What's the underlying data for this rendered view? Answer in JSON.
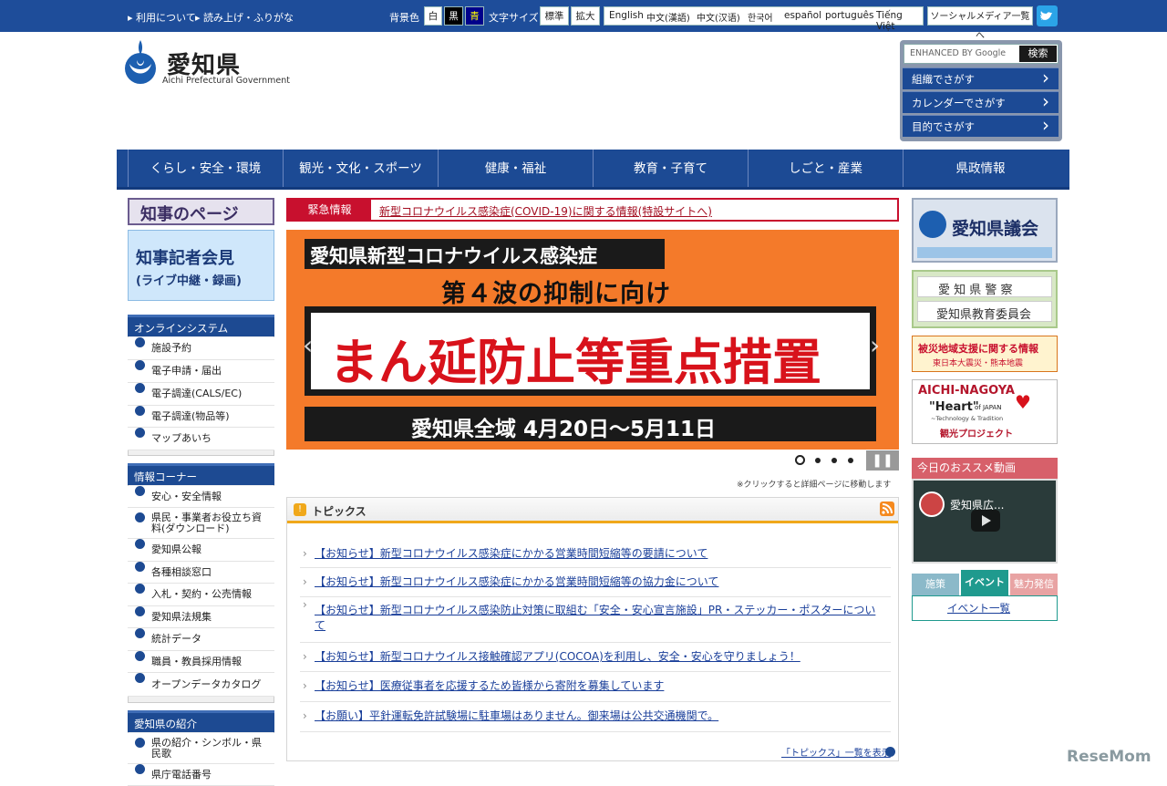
{
  "topbar": {
    "usage": "利用について",
    "reading": "読み上げ・ふりがな",
    "bg_label": "背景色",
    "bg_white": "白",
    "bg_black": "黒",
    "bg_blue": "青",
    "font_label": "文字サイズ",
    "font_standard": "標準",
    "font_large": "拡大",
    "langs": [
      "English",
      "中文(漢語)",
      "中文(汉语)",
      "한국어",
      "español",
      "português",
      "Tiếng Việt"
    ],
    "social": "ソーシャルメディア一覧へ"
  },
  "header": {
    "logo_title": "愛知県",
    "logo_sub": "Aichi Prefectural Government",
    "google_label": "ENHANCED BY Google",
    "search_button": "検索",
    "search_links": [
      "組織でさがす",
      "カレンダーでさがす",
      "目的でさがす"
    ]
  },
  "gnav": [
    "くらし・安全・環境",
    "観光・文化・スポーツ",
    "健康・福祉",
    "教育・子育て",
    "しごと・産業",
    "県政情報"
  ],
  "left": {
    "governor_page": "知事のページ",
    "press_line1": "知事記者会見",
    "press_line2": "(ライブ中継・録画)",
    "online_title": "オンラインシステム",
    "online_items": [
      "施設予約",
      "電子申請・届出",
      "電子調達(CALS/EC)",
      "電子調達(物品等)",
      "マップあいち"
    ],
    "info_title": "情報コーナー",
    "info_items": [
      "安心・安全情報",
      "県民・事業者お役立ち資料(ダウンロード)",
      "愛知県公報",
      "各種相談窓口",
      "入札・契約・公売情報",
      "愛知県法規集",
      "統計データ",
      "職員・教員採用情報",
      "オープンデータカタログ"
    ],
    "intro_title": "愛知県の紹介",
    "intro_items": [
      "県の紹介・シンボル・県民歌",
      "県庁電話番号"
    ]
  },
  "center": {
    "emergency_label": "緊急情報",
    "emergency_text": "新型コロナウイルス感染症(COVID-19)に関する情報(特設サイトへ)",
    "slide_line1": "愛知県新型コロナウイルス感染症",
    "slide_line2": "第４波の抑制に向け",
    "slide_line3": "まん延防止等重点措置",
    "slide_line4": "愛知県全域 4月20日～5月11日",
    "click_note": "※クリックすると詳細ページに移動します",
    "topics_title": "トピックス",
    "topics": [
      "【お知らせ】新型コロナウイルス感染症にかかる営業時間短縮等の要請について",
      "【お知らせ】新型コロナウイルス感染症にかかる営業時間短縮等の協力金について",
      "【お知らせ】新型コロナウイルス感染防止対策に取組む「安全・安心宣言施設」PR・ステッカー・ポスターについて",
      "【お知らせ】新型コロナウイルス接触確認アプリ(COCOA)を利用し、安全・安心を守りましょう！",
      "【お知らせ】医療従事者を応援するため皆様から寄附を募集しています",
      "【お願い】平針運転免許試験場に駐車場はありません。御来場は公共交通機関で。"
    ],
    "topics_more": "「トピックス」一覧を表示"
  },
  "right": {
    "assembly": "愛知県議会",
    "police": "愛 知 県 警 察",
    "education": "愛知県教育委員会",
    "disaster_line1": "被災地域支援に関する情報",
    "disaster_line2": "東日本大震災・熊本地震",
    "aichi_line1": "AICHI-NAGOYA",
    "aichi_line2": "\"Heart\"",
    "aichi_line2b": "of JAPAN",
    "aichi_line3": "~Technology & Tradition",
    "aichi_line4": "観光プロジェクト",
    "video_title": "今日のおススメ動画",
    "video_caption": "愛知県広...",
    "tabs": [
      "施策",
      "イベント",
      "魅力発信"
    ],
    "event_link": "イベント一覧"
  },
  "footer": {
    "watermark": "ReseMom"
  }
}
